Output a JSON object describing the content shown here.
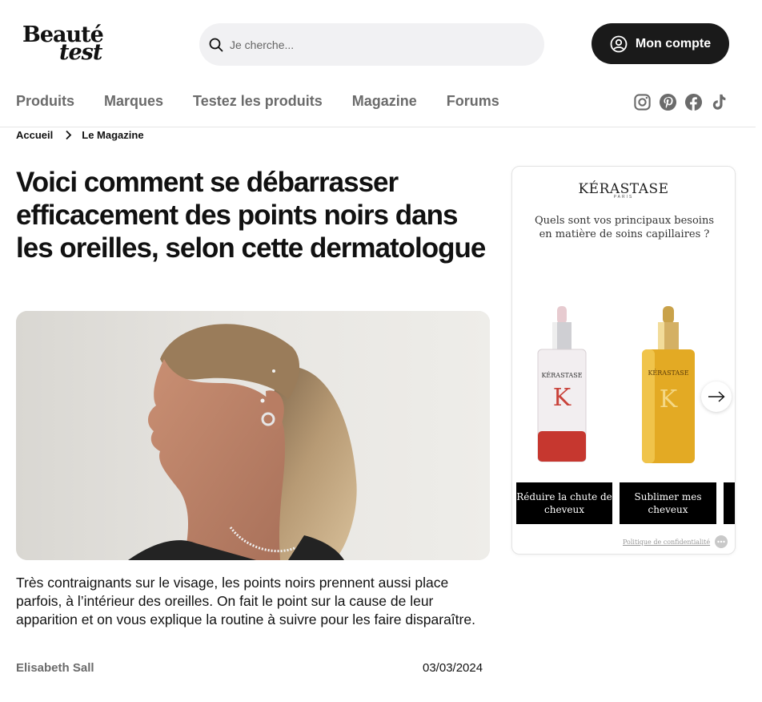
{
  "header": {
    "logo_line1": "Beauté",
    "logo_line2": "test",
    "search_placeholder": "Je cherche...",
    "account_label": "Mon compte"
  },
  "nav": {
    "items": [
      "Produits",
      "Marques",
      "Testez les produits",
      "Magazine",
      "Forums"
    ]
  },
  "social": [
    "instagram-icon",
    "pinterest-icon",
    "facebook-icon",
    "tiktok-icon"
  ],
  "breadcrumb": {
    "home": "Accueil",
    "current": "Le Magazine"
  },
  "article": {
    "title": "Voici comment se débarrasser efficacement des points noirs dans les oreilles, selon cette dermatologue",
    "lead": "Très contraignants sur le visage, les points noirs prennent aussi place parfois, à l’intérieur des oreilles. On fait le point sur la cause de leur apparition et on vous explique la routine à suivre pour les faire disparaître.",
    "author": "Elisabeth Sall",
    "date": "03/03/2024"
  },
  "ad": {
    "brand": "KÉRASTASE",
    "brand_sub": "PARIS",
    "question": "Quels sont vos principaux besoins en matière de soins capillaires ?",
    "choices": [
      "Réduire la chute de cheveux",
      "Sublimer mes cheveux",
      ""
    ],
    "privacy": "Politique de confidentialité",
    "product_label_1": "KÉRASTASE",
    "product_label_2": "KÉRASTASE",
    "product_letter": "K"
  },
  "colors": {
    "account_bg": "#1a1a1a",
    "nav_text": "#6b6b6b",
    "search_bg": "#f1f1f3",
    "ad_button_bg": "#000000"
  }
}
